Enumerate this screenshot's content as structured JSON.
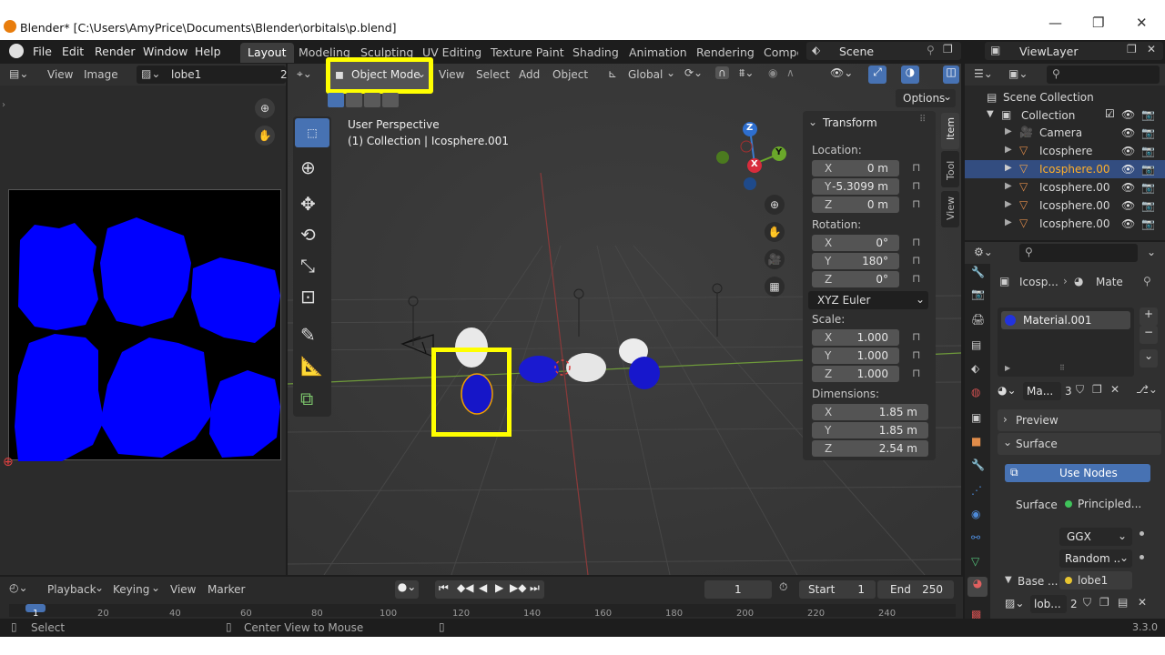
{
  "window": {
    "title": "Blender* [C:\\Users\\AmyPrice\\Documents\\Blender\\orbitals\\p.blend]",
    "minimize": "—",
    "restore": "❐",
    "close": "✕"
  },
  "menu": [
    "File",
    "Edit",
    "Render",
    "Window",
    "Help"
  ],
  "workspaces": [
    "Layout",
    "Modeling",
    "Sculpting",
    "UV Editing",
    "Texture Paint",
    "Shading",
    "Animation",
    "Rendering",
    "Compc"
  ],
  "scene": {
    "label": "Scene"
  },
  "viewlayer": {
    "label": "ViewLayer"
  },
  "image_editor": {
    "view": "View",
    "image": "Image",
    "image_name": "lobe1",
    "image_users": "2",
    "colors": {
      "bg": "#000000",
      "lobe": "#0000ff"
    }
  },
  "viewport": {
    "mode": "Object Mode",
    "menus": [
      "View",
      "Select",
      "Add",
      "Object"
    ],
    "orientation": "Global",
    "options": "Options",
    "overlay_line1": "User Perspective",
    "overlay_line2": "(1) Collection | Icosphere.001",
    "tabs": [
      "Item",
      "Tool",
      "View"
    ],
    "gizmo": {
      "z": "Z",
      "y": "Y",
      "x": "X"
    }
  },
  "transform": {
    "title": "Transform",
    "location_label": "Location:",
    "location": [
      {
        "axis": "X",
        "value": "0 m"
      },
      {
        "axis": "Y",
        "value": "-5.3099 m"
      },
      {
        "axis": "Z",
        "value": "0 m"
      }
    ],
    "rotation_label": "Rotation:",
    "rotation": [
      {
        "axis": "X",
        "value": "0°"
      },
      {
        "axis": "Y",
        "value": "180°"
      },
      {
        "axis": "Z",
        "value": "0°"
      }
    ],
    "rotation_mode": "XYZ Euler",
    "scale_label": "Scale:",
    "scale": [
      {
        "axis": "X",
        "value": "1.000"
      },
      {
        "axis": "Y",
        "value": "1.000"
      },
      {
        "axis": "Z",
        "value": "1.000"
      }
    ],
    "dimensions_label": "Dimensions:",
    "dimensions": [
      {
        "axis": "X",
        "value": "1.85 m"
      },
      {
        "axis": "Y",
        "value": "1.85 m"
      },
      {
        "axis": "Z",
        "value": "2.54 m"
      }
    ]
  },
  "outliner": {
    "root": "Scene Collection",
    "collection": "Collection",
    "items": [
      "Camera",
      "Icosphere",
      "Icosphere.00",
      "Icosphere.00",
      "Icosphere.00",
      "Icosphere.00"
    ]
  },
  "properties": {
    "breadcrumb_obj": "Icosp...",
    "breadcrumb_mat": "Mate",
    "material_slot": "Material.001",
    "material_short": "Ma...",
    "material_users": "3",
    "preview": "Preview",
    "surface_section": "Surface",
    "use_nodes": "Use Nodes",
    "surface_label": "Surface",
    "surface_value": "Principled...",
    "distribution": "GGX",
    "subsurface": "Random ...",
    "base_label": "Base ...",
    "base_value": "lobe1",
    "image_short": "lob...",
    "image_users": "2"
  },
  "timeline": {
    "menus": [
      "Playback",
      "Keying",
      "View",
      "Marker"
    ],
    "current_frame": "1",
    "start_label": "Start",
    "start": "1",
    "end_label": "End",
    "end": "250",
    "ticks": [
      "1",
      "20",
      "40",
      "60",
      "80",
      "100",
      "120",
      "140",
      "160",
      "180",
      "200",
      "220",
      "240"
    ]
  },
  "status": {
    "select": "Select",
    "center": "Center View to Mouse",
    "version": "3.3.0"
  },
  "highlight_color": "#ffff00"
}
